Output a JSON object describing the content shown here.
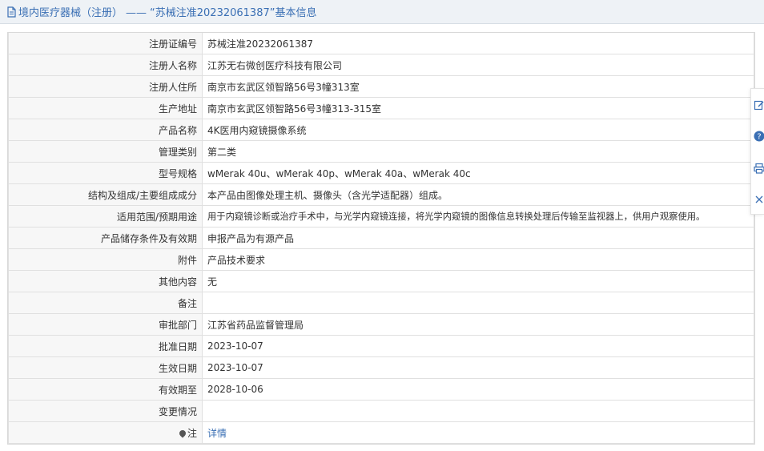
{
  "header": {
    "category": "境内医疗器械（注册）",
    "separator": "——",
    "suffix": "“苏械注准20232061387”基本信息"
  },
  "rows": [
    {
      "label": "注册证编号",
      "value": "苏械注准20232061387"
    },
    {
      "label": "注册人名称",
      "value": "江苏无右微创医疗科技有限公司"
    },
    {
      "label": "注册人住所",
      "value": "南京市玄武区领智路56号3幢313室"
    },
    {
      "label": "生产地址",
      "value": "南京市玄武区领智路56号3幢313-315室"
    },
    {
      "label": "产品名称",
      "value": "4K医用内窥镜摄像系统"
    },
    {
      "label": "管理类别",
      "value": "第二类"
    },
    {
      "label": "型号规格",
      "value": "wMerak 40u、wMerak 40p、wMerak 40a、wMerak 40c"
    },
    {
      "label": "结构及组成/主要组成成分",
      "value": "本产品由图像处理主机、摄像头（含光学适配器）组成。"
    },
    {
      "label": "适用范围/预期用途",
      "value": "用于内窥镜诊断或治疗手术中，与光学内窥镜连接，将光学内窥镜的图像信息转换处理后传输至监视器上，供用户观察使用。"
    },
    {
      "label": "产品储存条件及有效期",
      "value": "申报产品为有源产品"
    },
    {
      "label": "附件",
      "value": "产品技术要求"
    },
    {
      "label": "其他内容",
      "value": "无"
    },
    {
      "label": "备注",
      "value": ""
    },
    {
      "label": "审批部门",
      "value": "江苏省药品监督管理局"
    },
    {
      "label": "批准日期",
      "value": "2023-10-07"
    },
    {
      "label": "生效日期",
      "value": "2023-10-07"
    },
    {
      "label": "有效期至",
      "value": "2028-10-06"
    },
    {
      "label": "变更情况",
      "value": ""
    }
  ],
  "note_row": {
    "label": "注",
    "link_text": "详情"
  },
  "icons": {
    "header": "document-icon",
    "note": "pin-icon",
    "tools": [
      "edit-icon",
      "help-icon",
      "print-icon",
      "close-icon"
    ]
  },
  "colors": {
    "accent": "#3a6fb4",
    "header_bg": "#eef2f6",
    "label_bg": "#f7f7f7"
  }
}
